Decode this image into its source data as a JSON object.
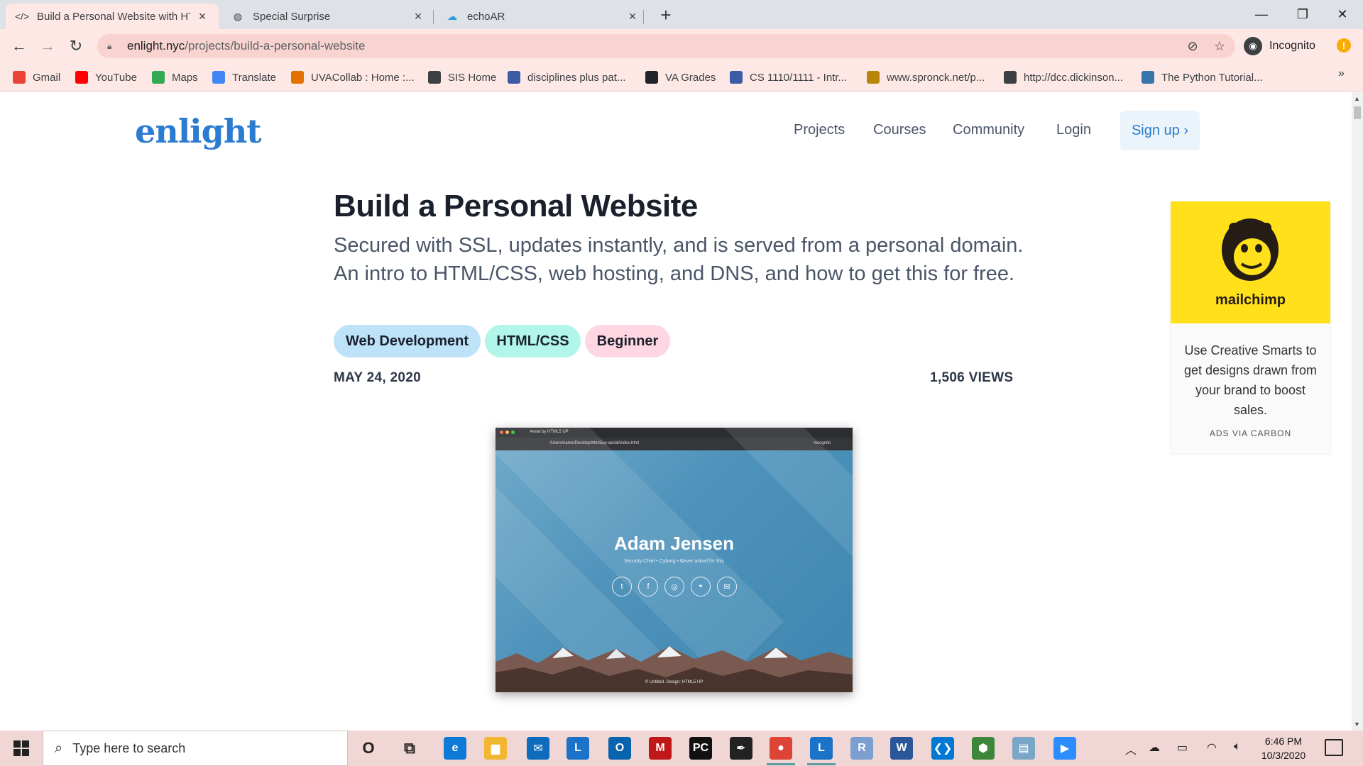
{
  "browser": {
    "tabs": [
      {
        "title": "Build a Personal Website with HT",
        "icon": "code-icon",
        "active": true
      },
      {
        "title": "Special Surprise",
        "icon": "globe-icon",
        "active": false
      },
      {
        "title": "echoAR",
        "icon": "cloud-icon",
        "active": false
      }
    ],
    "address": {
      "domain": "enlight.nyc",
      "path": "/projects/build-a-personal-website"
    },
    "profile_label": "Incognito",
    "bookmarks": [
      {
        "label": "Gmail",
        "icon": "gmail-icon",
        "color": "#ea4335"
      },
      {
        "label": "YouTube",
        "icon": "youtube-icon",
        "color": "#ff0000"
      },
      {
        "label": "Maps",
        "icon": "maps-icon",
        "color": "#34a853"
      },
      {
        "label": "Translate",
        "icon": "translate-icon",
        "color": "#4285f4"
      },
      {
        "label": "UVACollab : Home :...",
        "icon": "uvacollab-icon",
        "color": "#e57200"
      },
      {
        "label": "SIS Home",
        "icon": "globe-icon",
        "color": "#3c4043"
      },
      {
        "label": "disciplines plus pat...",
        "icon": "institution-icon",
        "color": "#3b5ba5"
      },
      {
        "label": "VA Grades",
        "icon": "react-icon",
        "color": "#20232a"
      },
      {
        "label": "CS 1110/1111 - Intr...",
        "icon": "institution-icon",
        "color": "#3b5ba5"
      },
      {
        "label": "www.spronck.net/p...",
        "icon": "spronck-icon",
        "color": "#b8860b"
      },
      {
        "label": "http://dcc.dickinson...",
        "icon": "globe-icon",
        "color": "#3c4043"
      },
      {
        "label": "The Python Tutorial...",
        "icon": "python-icon",
        "color": "#3776ab"
      }
    ]
  },
  "site": {
    "logo": "enlight",
    "nav": [
      "Projects",
      "Courses",
      "Community",
      "Login"
    ],
    "signup": "Sign up ›"
  },
  "article": {
    "title": "Build a Personal Website",
    "subtitle": "Secured with SSL, updates instantly, and is served from a personal domain. An intro to HTML/CSS, web hosting, and DNS, and how to get this for free.",
    "tags": [
      {
        "label": "Web Development",
        "color": "#bee3f8"
      },
      {
        "label": "HTML/CSS",
        "color": "#b2f5ea"
      },
      {
        "label": "Beginner",
        "color": "#fed7e2"
      }
    ],
    "date": "MAY 24, 2020",
    "views": "1,506 VIEWS"
  },
  "hero": {
    "name": "Adam Jensen",
    "tagline": "Security Chief • Cyborg • Never asked for this",
    "tab_title": "Aerial by HTML5 UP",
    "url": "/Users/name/Desktop/html5up-aerial/index.html",
    "incognito": "Incognito",
    "footer": "© Untitled. Design: HTML5 UP",
    "social_icons": [
      "twitter-icon",
      "facebook-icon",
      "dribbble-icon",
      "github-icon",
      "envelope-icon"
    ]
  },
  "ad": {
    "brand": "mailchimp",
    "text": "Use Creative Smarts to get designs drawn from your brand to boost sales.",
    "via": "ADS VIA CARBON",
    "bg_color": "#ffe01b"
  },
  "taskbar": {
    "search_placeholder": "Type here to search",
    "apps": [
      {
        "name": "cortana-icon",
        "glyph": "O",
        "color": "transparent"
      },
      {
        "name": "task-view-icon",
        "glyph": "⧉",
        "color": "transparent"
      },
      {
        "name": "edge-icon",
        "glyph": "e",
        "color": "#0f7ad6"
      },
      {
        "name": "file-explorer-icon",
        "glyph": "▆",
        "color": "#f2b630"
      },
      {
        "name": "mail-icon",
        "glyph": "✉",
        "color": "#0f6cbd"
      },
      {
        "name": "l-app-icon",
        "glyph": "L",
        "color": "#1a73c8"
      },
      {
        "name": "outlook-icon",
        "glyph": "O",
        "color": "#0a64ad"
      },
      {
        "name": "mcafee-icon",
        "glyph": "M",
        "color": "#c01818"
      },
      {
        "name": "pycharm-icon",
        "glyph": "PC",
        "color": "#111111"
      },
      {
        "name": "inkscape-icon",
        "glyph": "✒",
        "color": "#222222"
      },
      {
        "name": "chrome-icon",
        "glyph": "●",
        "color": "#db4437"
      },
      {
        "name": "l-app-icon-2",
        "glyph": "L",
        "color": "#1a73c8"
      },
      {
        "name": "r-icon",
        "glyph": "R",
        "color": "#7b9fd0"
      },
      {
        "name": "word-icon",
        "glyph": "W",
        "color": "#2b579a"
      },
      {
        "name": "vscode-icon",
        "glyph": "❮❯",
        "color": "#0078d4"
      },
      {
        "name": "nodejs-icon",
        "glyph": "⬢",
        "color": "#3c873a"
      },
      {
        "name": "notes-icon",
        "glyph": "▤",
        "color": "#7aa7c7"
      },
      {
        "name": "zoom-icon",
        "glyph": "▶",
        "color": "#2d8cff"
      }
    ],
    "time": "6:46 PM",
    "date": "10/3/2020"
  }
}
